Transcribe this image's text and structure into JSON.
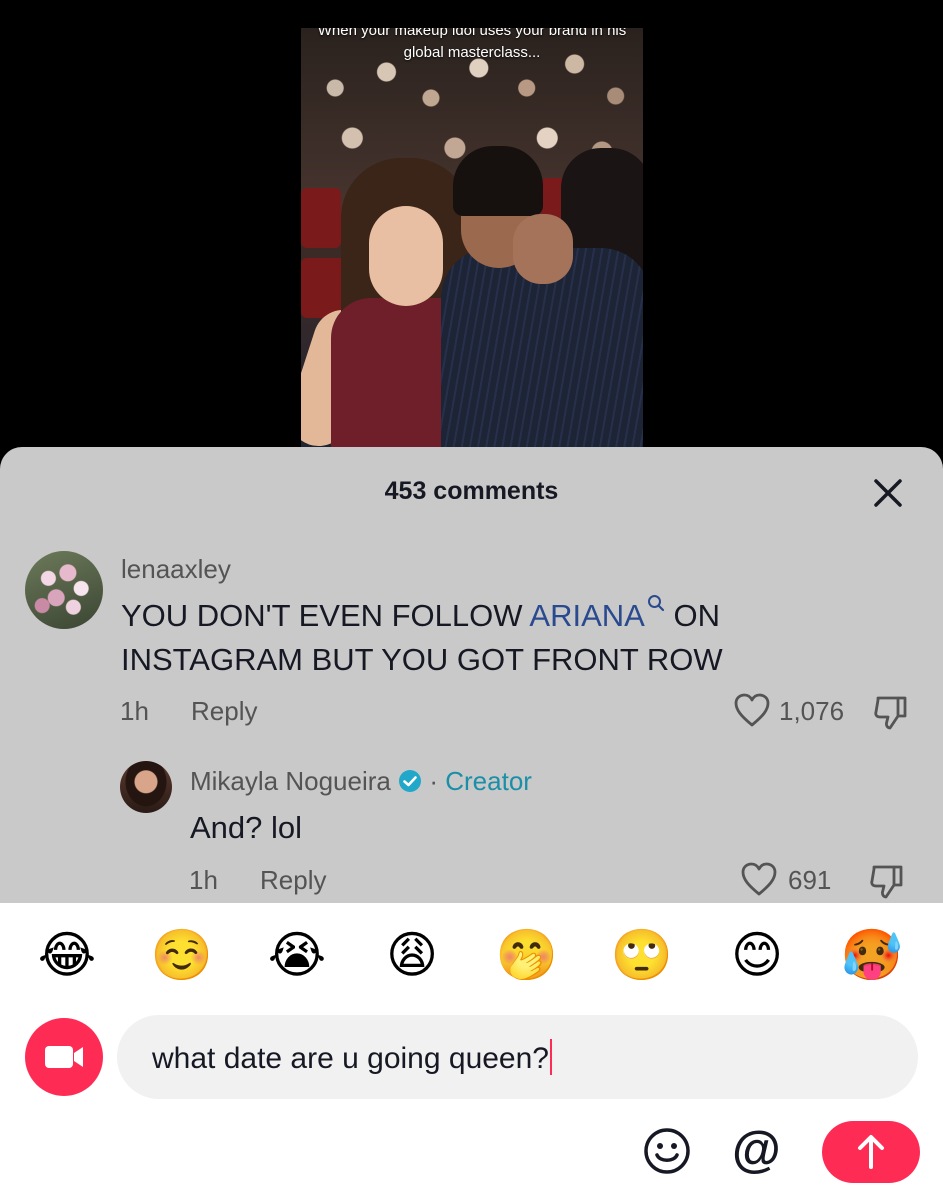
{
  "video": {
    "overlay_text": "When your makeup idol uses your brand in his global masterclass..."
  },
  "comments": {
    "count_title": "453 comments",
    "items": [
      {
        "username": "lenaaxley",
        "text_before": "YOU DON'T EVEN FOLLOW ",
        "mention": "ARIANA",
        "text_after": " ON INSTAGRAM BUT YOU GOT FRONT ROW",
        "time": "1h",
        "reply_label": "Reply",
        "likes": "1,076"
      },
      {
        "username": "Mikayla Nogueira",
        "badge_separator": "·",
        "role": "Creator",
        "text": "And? lol",
        "time": "1h",
        "reply_label": "Reply",
        "likes": "691"
      }
    ]
  },
  "emoji_bar": [
    "😂",
    "☺️",
    "😭",
    "😩",
    "🤭",
    "🙄",
    "😊",
    "🥵"
  ],
  "composer": {
    "input_value": "what date are u going queen?"
  },
  "colors": {
    "accent": "#fe2c55",
    "mention": "#2a4a8f",
    "creator": "#1b8fa8",
    "sheet_bg": "#c9c9c9"
  },
  "icons": [
    "close-icon",
    "search-icon",
    "heart-icon",
    "dislike-icon",
    "verified-icon",
    "camera-icon",
    "emoji-icon",
    "at-icon",
    "arrow-up-icon"
  ]
}
